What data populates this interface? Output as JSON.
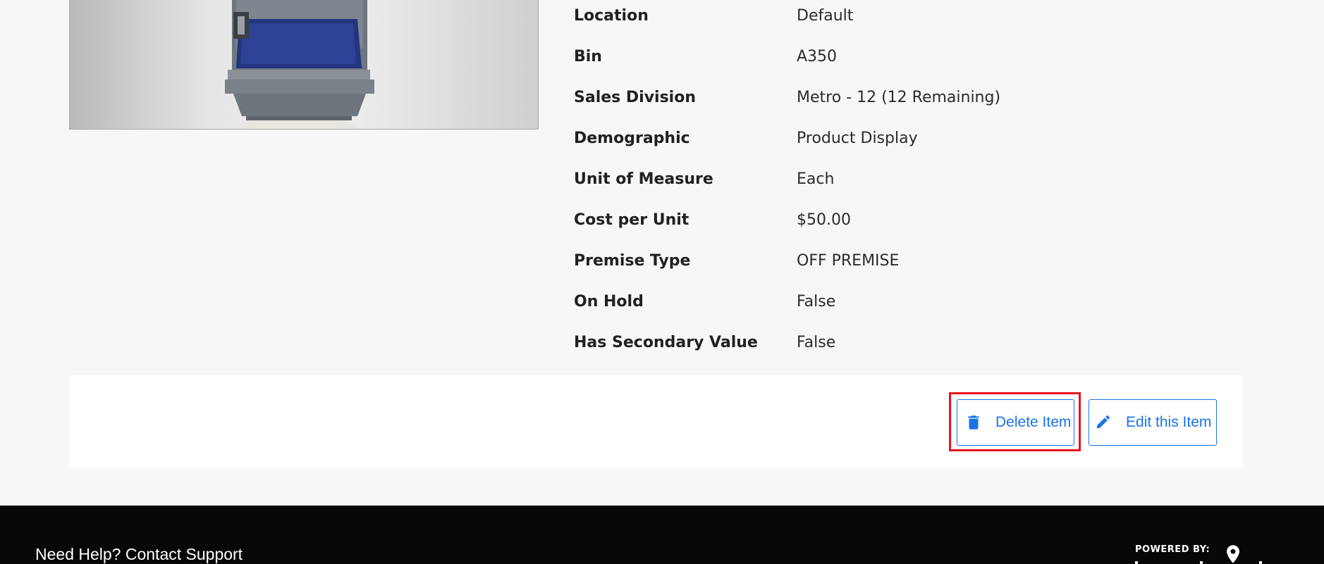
{
  "details": [
    {
      "label": "Location",
      "value": "Default"
    },
    {
      "label": "Bin",
      "value": "A350"
    },
    {
      "label": "Sales Division",
      "value": "Metro - 12 (12 Remaining)"
    },
    {
      "label": "Demographic",
      "value": "Product Display"
    },
    {
      "label": "Unit of Measure",
      "value": "Each"
    },
    {
      "label": "Cost per Unit",
      "value": "$50.00"
    },
    {
      "label": "Premise Type",
      "value": "OFF PREMISE"
    },
    {
      "label": "On Hold",
      "value": "False"
    },
    {
      "label": "Has Secondary Value",
      "value": "False"
    }
  ],
  "actions": {
    "delete_label": "Delete Item",
    "edit_label": "Edit this Item",
    "delete_icon": "trash-icon",
    "edit_icon": "pencil-icon"
  },
  "footer": {
    "help_text": "Need Help? Contact Support",
    "powered_by": "POWERED BY:"
  },
  "colors": {
    "accent": "#1a73e8",
    "highlight": "#e8141d",
    "footer_bg": "#07070a",
    "page_bg": "#f7f7f7"
  }
}
